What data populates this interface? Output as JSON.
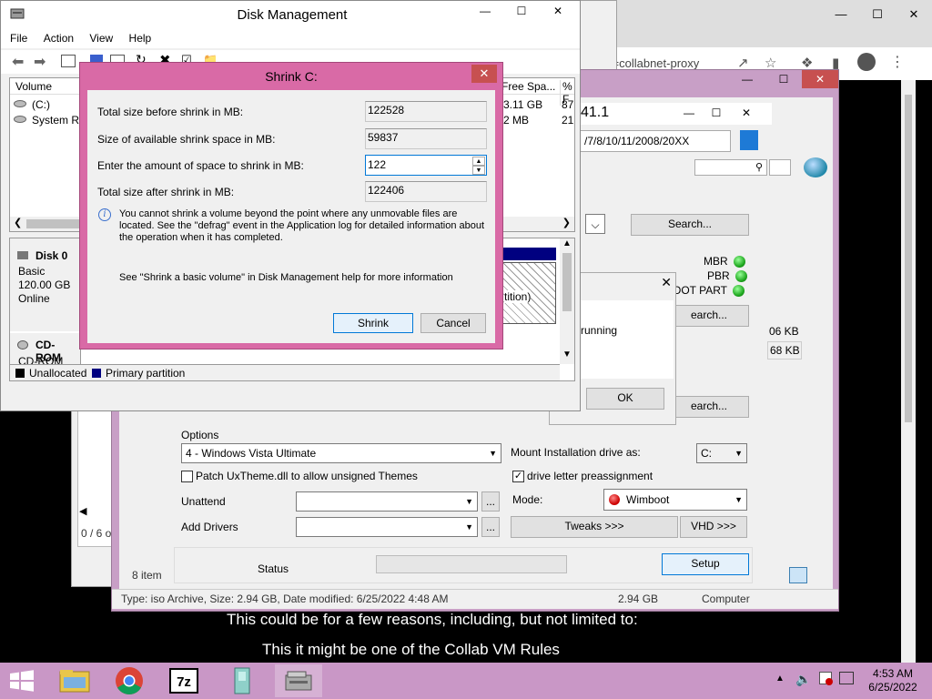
{
  "disk_mgmt": {
    "title": "Disk Management",
    "menu": [
      "File",
      "Action",
      "View",
      "Help"
    ],
    "columns": [
      "Volume",
      "Free Spa...",
      "% F"
    ],
    "volumes": [
      {
        "name": "(C:)",
        "free": "3.11 GB",
        "pct": "87"
      },
      {
        "name": "System Res",
        "free": "2 MB",
        "pct": "21"
      }
    ],
    "disk0": {
      "name": "Disk 0",
      "type": "Basic",
      "size": "120.00 GB",
      "status": "Online"
    },
    "partition_label": "tition)",
    "cdrom": {
      "name": "CD-ROM",
      "drive": "CD-ROM (D:)"
    },
    "legend": {
      "unallocated": "Unallocated",
      "primary": "Primary partition"
    }
  },
  "shrink": {
    "title": "Shrink C:",
    "rows": [
      {
        "label": "Total size before shrink in MB:",
        "value": "122528"
      },
      {
        "label": "Size of available shrink space in MB:",
        "value": "59837"
      },
      {
        "label": "Enter the amount of space to shrink in MB:",
        "value": "122"
      },
      {
        "label": "Total size after shrink in MB:",
        "value": "122406"
      }
    ],
    "info": "You cannot shrink a volume beyond the point where any unmovable files are located. See the \"defrag\" event in the Application log for detailed information about the operation when it has completed.",
    "help": "See \"Shrink a basic volume\" in Disk Management help for more information",
    "shrink_button": "Shrink",
    "cancel_button": "Cancel"
  },
  "browser": {
    "url_fragment": "egory=collabnet-proxy",
    "caption1": "This could be for a few reasons, including, but not limited to:",
    "caption2": "This it might be one of the Collab VM Rules"
  },
  "winntsetup": {
    "title": "41.1",
    "path": "/7/8/10/11/2008/20XX",
    "search1": "Search...",
    "search2": "earch...",
    "search3": "earch...",
    "mbr": "MBR",
    "pbr": "PBR",
    "bootpart": "OOT PART",
    "size1": "06 KB",
    "size2": "68 KB",
    "msg_text": "ent running",
    "ok_button": "OK",
    "options_label": "Options",
    "edition": "4 - Windows Vista Ultimate",
    "mount_label": "Mount Installation drive as:",
    "mount_value": "C:",
    "patch_label": "Patch UxTheme.dll to allow unsigned Themes",
    "drive_letter_label": "drive letter preassignment",
    "unattend_label": "Unattend",
    "add_drivers_label": "Add Drivers",
    "browse": "...",
    "mode_label": "Mode:",
    "mode_value": "Wimboot",
    "tweaks_button": "Tweaks >>>",
    "vhd_button": "VHD >>>",
    "status_label": "Status",
    "setup_button": "Setup"
  },
  "explorer": {
    "count": "0 / 6 o",
    "items": "8 item",
    "statusbar": "Type: iso Archive, Size: 2.94 GB, Date modified: 6/25/2022 4:48 AM",
    "status_size": "2.94 GB",
    "status_location": "Computer"
  },
  "taskbar": {
    "time": "4:53 AM",
    "date": "6/25/2022"
  },
  "colors": {
    "shrink_frame": "#d96aa6",
    "taskbar": "#c997c6",
    "winnt_frame": "#c89fc6",
    "primary_partition": "#000080"
  }
}
